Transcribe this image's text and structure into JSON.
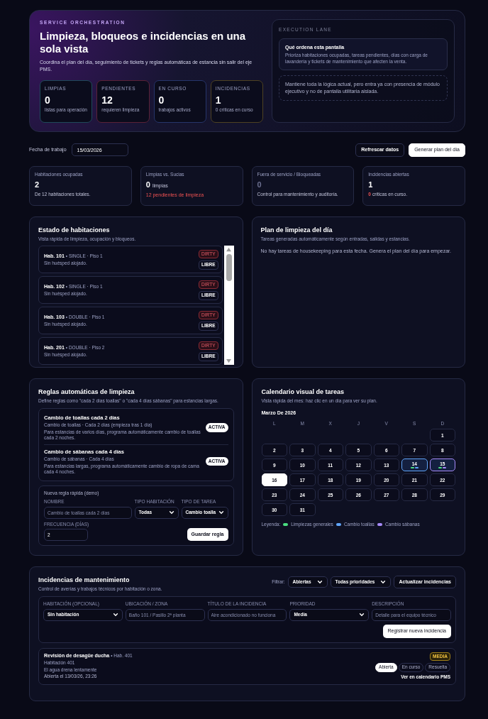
{
  "hero": {
    "eyebrow": "SERVICE ORCHESTRATION",
    "title": "Limpieza, bloqueos e incidencias en una sola vista",
    "subtitle": "Coordina el plan del día, seguimiento de tickets y reglas automáticas de estancia sin salir del eje PMS.",
    "stats": [
      {
        "label": "LIMPIAS",
        "value": "0",
        "note": "listas para operación",
        "color": "#1f4a5a"
      },
      {
        "label": "PENDIENTES",
        "value": "12",
        "note": "requieren limpieza",
        "color": "#5a2236"
      },
      {
        "label": "EN CURSO",
        "value": "0",
        "note": "trabajos activos",
        "color": "#26356a"
      },
      {
        "label": "INCIDENCIAS",
        "value": "1",
        "note": "0 críticas en curso",
        "color": "#4e4222"
      }
    ],
    "lane": {
      "label": "EXECUTION LANE",
      "card_title": "Qué ordena esta pantalla",
      "card_text": "Prioriza habitaciones ocupadas, tareas pendientes, días con carga de lavandería y tickets de mantenimiento que afecten la venta.",
      "note": "Mantiene toda la lógica actual, pero entra ya con presencia de módulo ejecutivo y no de pantalla utilitaria aislada."
    }
  },
  "toolbar": {
    "date_label": "Fecha de trabajo",
    "date": "15/03/2026",
    "buttons": [
      {
        "label": "Refrescar datos",
        "kind": "secondary"
      },
      {
        "label": "Generar plan del día",
        "kind": "primary"
      }
    ]
  },
  "kpis": [
    {
      "label": "Habitaciones ocupadas",
      "value": "2",
      "note": "De 12 habitaciones totales.",
      "kind": "plain"
    },
    {
      "label": "Limpias vs. Sucias",
      "value": "0",
      "unit": "limpias",
      "note": "12 pendientes de limpieza",
      "kind": "alert"
    },
    {
      "label": "Fuera de servicio / Bloqueadas",
      "value": "0",
      "note": "Control para mantenimiento y auditoría.",
      "kind": "muted"
    },
    {
      "label": "Incidencias abiertas",
      "value": "1",
      "count": "0",
      "note": "críticas en curso.",
      "kind": "count"
    }
  ],
  "rooms_panel": {
    "title": "Estado de habitaciones",
    "subtitle": "Vista rápida de limpieza, ocupación y bloqueos.",
    "rooms": [
      {
        "number": "Hab. 101",
        "type": "• SINGLE · Piso 1",
        "guest": "Sin huésped alojado.",
        "status": "DIRTY",
        "kind": "dirty",
        "occupancy": "LIBRE"
      },
      {
        "number": "Hab. 102",
        "type": "• SINGLE · Piso 1",
        "guest": "Sin huésped alojado.",
        "status": "DIRTY",
        "kind": "dirty",
        "occupancy": "LIBRE"
      },
      {
        "number": "Hab. 103",
        "type": "• DOUBLE · Piso 1",
        "guest": "Sin huésped alojado.",
        "status": "DIRTY",
        "kind": "dirty",
        "occupancy": "LIBRE"
      },
      {
        "number": "Hab. 201",
        "type": "• DOUBLE · Piso 2",
        "guest": "Sin huésped alojado.",
        "status": "DIRTY",
        "kind": "dirty",
        "occupancy": "LIBRE"
      }
    ]
  },
  "plan_panel": {
    "title": "Plan de limpieza del día",
    "subtitle": "Tareas generadas automáticamente según entradas, salidas y estancias.",
    "empty": "No hay tareas de housekeeping para esta fecha. Genera el plan del día para empezar."
  },
  "rules": {
    "title": "Reglas automáticas de limpieza",
    "subtitle": "Define reglas como \"cada 2 días toallas\" o \"cada 4 días sábanas\" para estancias largas.",
    "items": [
      {
        "title": "Cambio de toallas cada 2 días",
        "meta": "Cambio de toallas · Cada 2 días (empieza tras 1 día)",
        "description": "Para estancias de varios días, programa automáticamente cambio de toallas cada 2 noches.",
        "badge": "ACTIVA",
        "active": true
      },
      {
        "title": "Cambio de sábanas cada 4 días",
        "meta": "Cambio de sábanas · Cada 4 días",
        "description": "Para estancias largas, programa automáticamente cambio de ropa de cama cada 4 noches.",
        "badge": "ACTIVA",
        "active": true
      }
    ],
    "form": {
      "title": "Nueva regla rápida (demo)",
      "fields": [
        {
          "label": "NOMBRE",
          "kind": "text",
          "placeholder": "Cambio de toallas cada 2 días"
        },
        {
          "label": "TIPO HABITACIÓN",
          "kind": "select",
          "value": "Todas"
        },
        {
          "label": "TIPO DE TAREA",
          "kind": "select",
          "value": "Cambio toalla"
        },
        {
          "label": "FRECUENCIA (DÍAS)",
          "kind": "text",
          "value": "2"
        }
      ],
      "button": "Guardar regla"
    }
  },
  "calendar": {
    "title": "Calendario visual de tareas",
    "subtitle": "Vista rápida del mes: haz clic en un día para ver su plan.",
    "month": "Marzo De 2026",
    "weekdays": [
      "L",
      "M",
      "X",
      "J",
      "V",
      "S",
      "D"
    ],
    "weeks": [
      [
        {
          "day": "1",
          "selected": false
        }
      ],
      [
        {
          "day": "2",
          "selected": false
        },
        {
          "day": "3",
          "selected": false
        },
        {
          "day": "4",
          "selected": false
        },
        {
          "day": "5",
          "selected": false
        },
        {
          "day": "6",
          "selected": false
        },
        {
          "day": "7",
          "selected": false
        },
        {
          "day": "8",
          "selected": false
        }
      ],
      [
        {
          "day": "9",
          "selected": false
        },
        {
          "day": "10",
          "selected": false
        },
        {
          "day": "11",
          "selected": false
        },
        {
          "day": "12",
          "selected": false
        },
        {
          "day": "13",
          "selected": false
        },
        {
          "day": "14",
          "selected": false,
          "tasks": [
            {
              "kind": "general"
            },
            {
              "kind": "towels"
            }
          ]
        },
        {
          "day": "15",
          "selected": false,
          "tasks": [
            {
              "kind": "general"
            },
            {
              "kind": "sheets"
            }
          ]
        }
      ],
      [
        {
          "day": "16",
          "selected": true
        },
        {
          "day": "17",
          "selected": false
        },
        {
          "day": "18",
          "selected": false
        },
        {
          "day": "19",
          "selected": false
        },
        {
          "day": "20",
          "selected": false
        },
        {
          "day": "21",
          "selected": false
        },
        {
          "day": "22",
          "selected": false
        }
      ],
      [
        {
          "day": "23",
          "selected": false
        },
        {
          "day": "24",
          "selected": false
        },
        {
          "day": "25",
          "selected": false
        },
        {
          "day": "26",
          "selected": false
        },
        {
          "day": "27",
          "selected": false
        },
        {
          "day": "28",
          "selected": false
        },
        {
          "day": "29",
          "selected": false
        }
      ],
      [
        {
          "day": "30",
          "selected": false
        },
        {
          "day": "31",
          "selected": false
        }
      ]
    ],
    "legend_label": "Leyenda:",
    "legend": [
      {
        "label": "Limpiezas generales",
        "kind": "general",
        "color": "#4ade80"
      },
      {
        "label": "Cambio toallas",
        "kind": "towels",
        "color": "#60a5fa"
      },
      {
        "label": "Cambio sábanas",
        "kind": "sheets",
        "color": "#a78bfa"
      }
    ]
  },
  "incidents": {
    "title": "Incidencias de mantenimiento",
    "subtitle": "Control de averías y trabajos técnicos por habitación o zona.",
    "filter_label": "Filtrar:",
    "filters": [
      {
        "value": "Abiertas"
      },
      {
        "value": "Todas prioridades"
      }
    ],
    "refresh": "Actualizar incidencias",
    "form": {
      "fields": [
        {
          "label": "HABITACIÓN (OPCIONAL)",
          "kind": "select",
          "value": "Sin habitación"
        },
        {
          "label": "UBICACIÓN / ZONA",
          "kind": "text",
          "placeholder": "Baño 101 / Pasillo 2ª planta"
        },
        {
          "label": "TÍTULO DE LA INCIDENCIA",
          "kind": "text",
          "placeholder": "Aire acondicionado no funciona"
        },
        {
          "label": "PRIORIDAD",
          "kind": "select",
          "value": "Media"
        },
        {
          "label": "DESCRIPCIÓN",
          "kind": "text",
          "placeholder": "Detalle para el equipo técnico"
        }
      ],
      "button": "Registrar nueva incidencia"
    },
    "items": [
      {
        "title": "Revisión de desagüe ducha",
        "room": "• Hab. 401",
        "location": "Habitación 401",
        "description": "El agua drena lentamente",
        "opened": "Abierta el 13/03/26, 23:26",
        "priority": "MEDIA",
        "kind": "medium",
        "statuses": [
          {
            "label": "Abierta",
            "selected": true
          },
          {
            "label": "En curso",
            "selected": false
          },
          {
            "label": "Resuelta",
            "selected": false
          }
        ],
        "link": "Ver en calendario PMS"
      }
    ]
  }
}
